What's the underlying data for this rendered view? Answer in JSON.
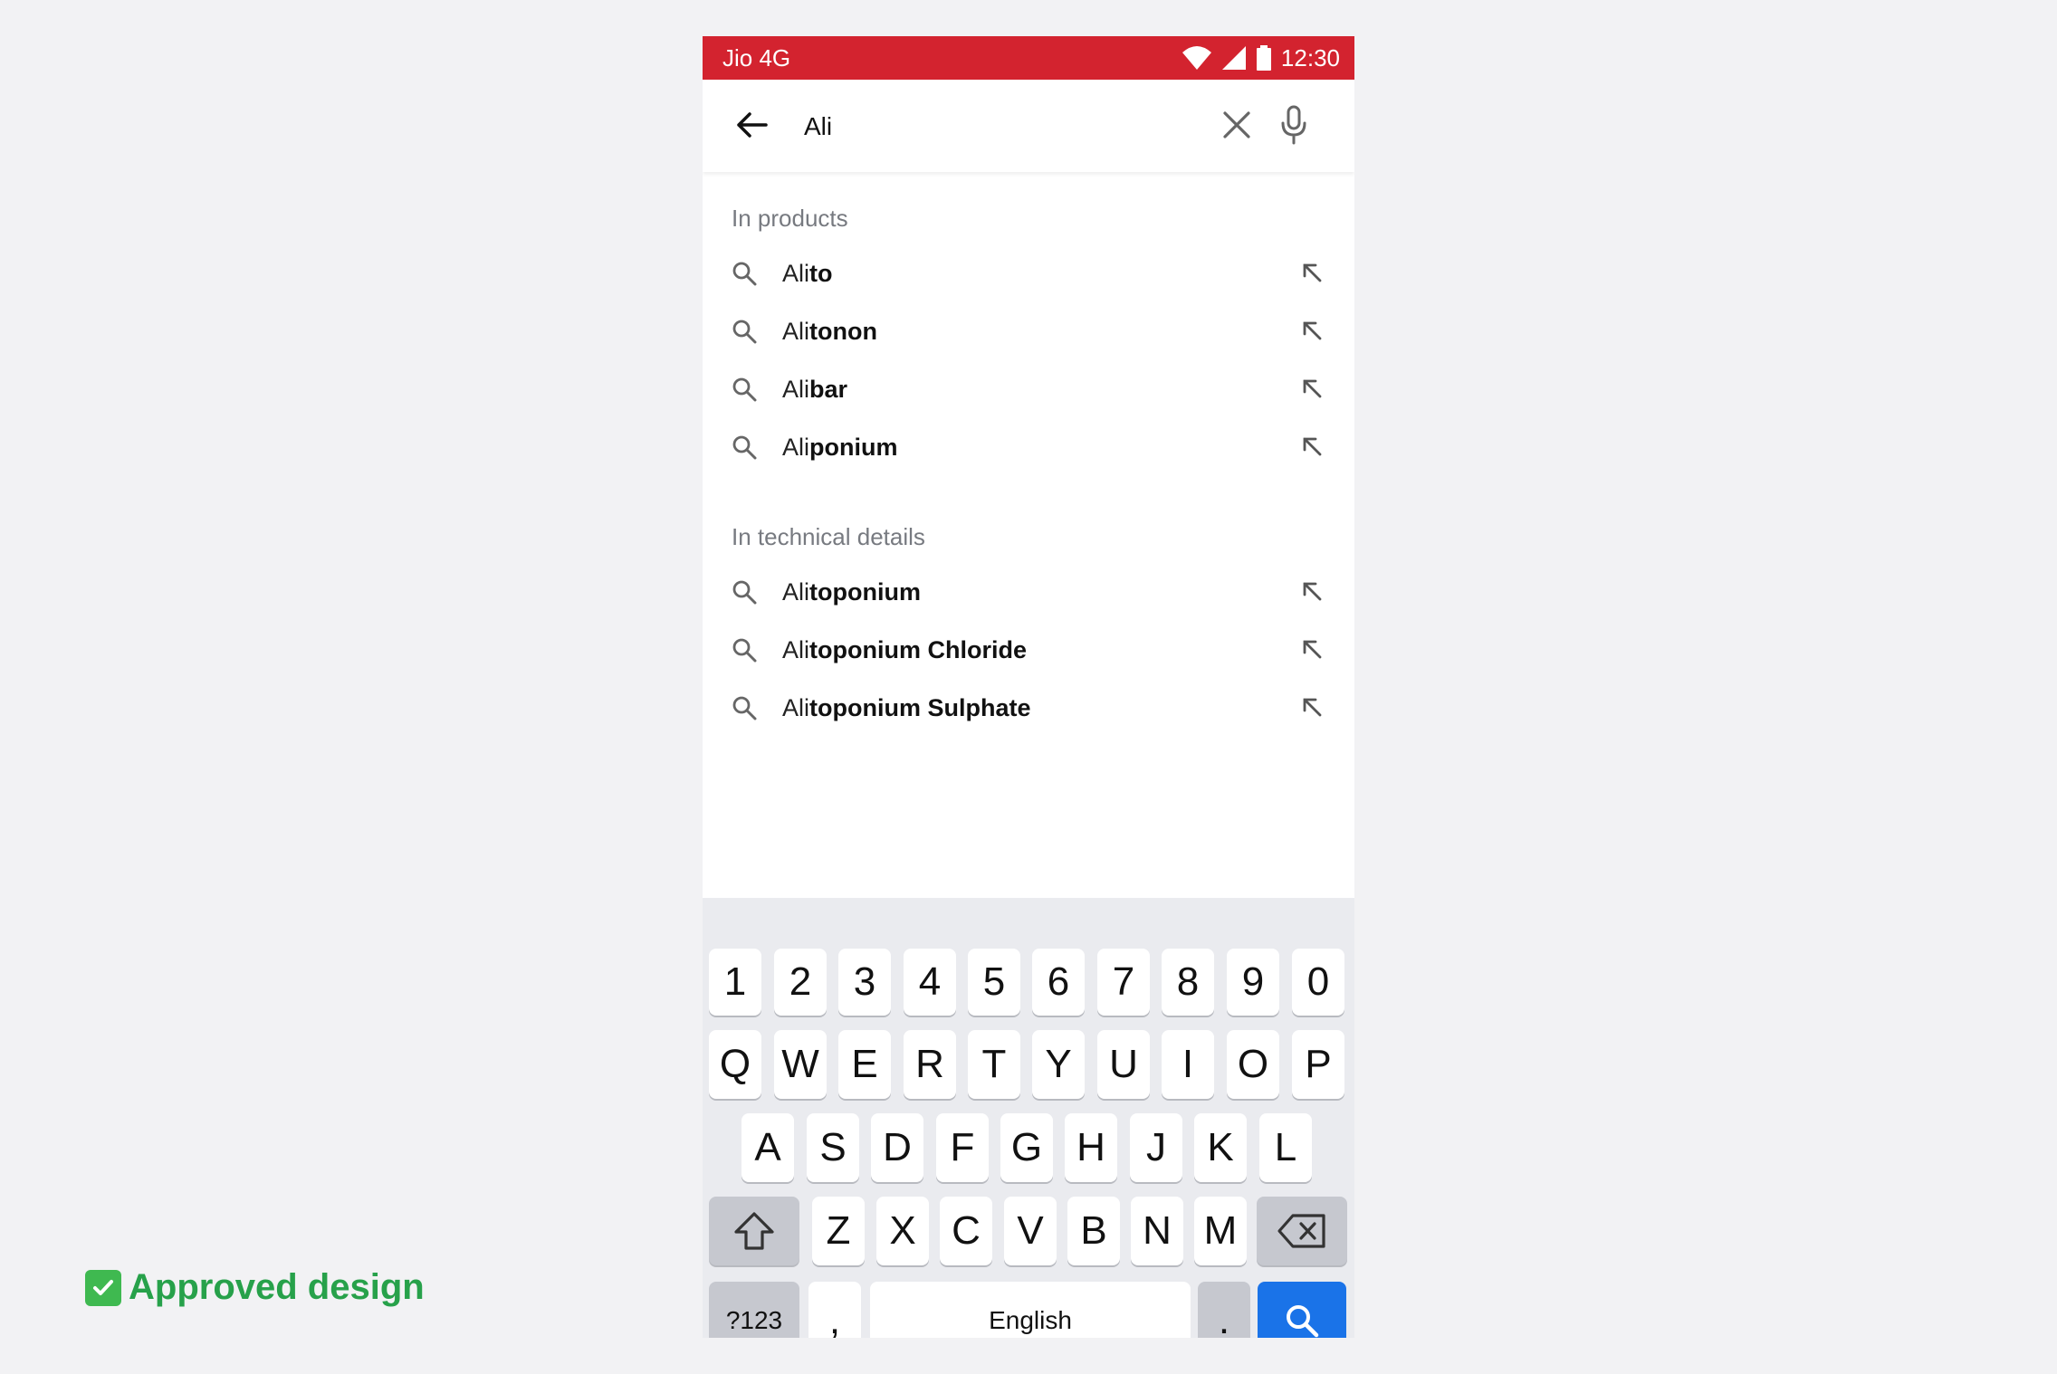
{
  "status_bar": {
    "carrier": "Jio 4G",
    "time": "12:30",
    "color": "#d3232f"
  },
  "search": {
    "query": "Ali",
    "back_icon": "arrow-left-icon",
    "clear_icon": "close-icon",
    "mic_icon": "mic-icon"
  },
  "sections": [
    {
      "title": "In products",
      "items": [
        {
          "prefix": "Ali",
          "suffix": "to"
        },
        {
          "prefix": "Ali",
          "suffix": "tonon"
        },
        {
          "prefix": "Ali",
          "suffix": "bar"
        },
        {
          "prefix": "Ali",
          "suffix": "ponium"
        }
      ]
    },
    {
      "title": "In technical details",
      "items": [
        {
          "prefix": "Ali",
          "suffix": "toponium"
        },
        {
          "prefix": "Ali",
          "suffix": "toponium Chloride"
        },
        {
          "prefix": "Ali",
          "suffix": "toponium Sulphate"
        }
      ]
    }
  ],
  "keyboard": {
    "row_numbers": [
      "1",
      "2",
      "3",
      "4",
      "5",
      "6",
      "7",
      "8",
      "9",
      "0"
    ],
    "row_1": [
      "Q",
      "W",
      "E",
      "R",
      "T",
      "Y",
      "U",
      "I",
      "O",
      "P"
    ],
    "row_2": [
      "A",
      "S",
      "D",
      "F",
      "G",
      "H",
      "J",
      "K",
      "L"
    ],
    "row_3": [
      "Z",
      "X",
      "C",
      "V",
      "B",
      "N",
      "M"
    ],
    "symbols_key": "?123",
    "comma_key": ",",
    "space_key": "English",
    "period_key": ".",
    "shift_icon": "shift-icon",
    "backspace_icon": "backspace-icon",
    "search_icon": "search-icon",
    "accent": "#1a73e8"
  },
  "footer": {
    "label": "Approved design",
    "color": "#27a14a"
  }
}
